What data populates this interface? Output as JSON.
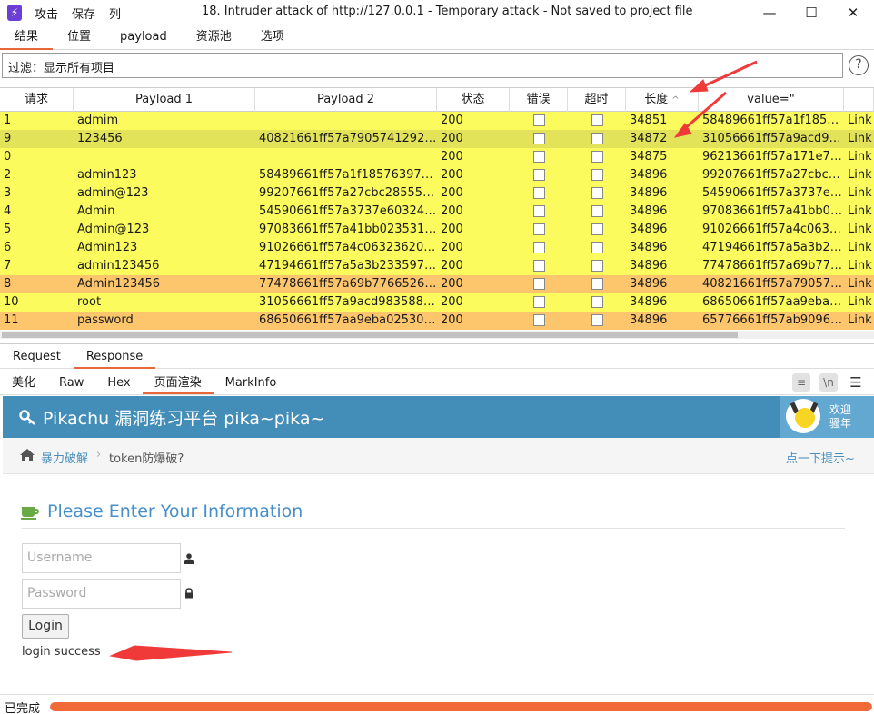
{
  "app": {
    "icon_glyph": "⚡",
    "menu": [
      "攻击",
      "保存",
      "列"
    ],
    "window_title": "18. Intruder attack of http://127.0.0.1 - Temporary attack - Not saved to project file",
    "window_buttons": {
      "minimize": "—",
      "maximize": "☐",
      "close": "✕"
    }
  },
  "main_tabs": [
    "结果",
    "位置",
    "payload",
    "资源池",
    "选项"
  ],
  "filter": {
    "text": "过滤：显示所有项目",
    "help": "?"
  },
  "table": {
    "columns": [
      "请求",
      "Payload 1",
      "Payload 2",
      "状态",
      "错误",
      "超时",
      "长度",
      "value=\""
    ],
    "sort_indicator": "^",
    "rows": [
      {
        "id": "1",
        "p1": "admim",
        "p2": "",
        "status": "200",
        "len": "34851",
        "value": "58489661ff57a1f1857...",
        "extra": "Link",
        "highlight": "yellow"
      },
      {
        "id": "9",
        "p1": "123456",
        "p2": "40821661ff57a79057412924...",
        "status": "200",
        "len": "34872",
        "value": "31056661ff57a9acd98...",
        "extra": "Link",
        "highlight": "selected"
      },
      {
        "id": "0",
        "p1": "",
        "p2": "",
        "status": "200",
        "len": "34875",
        "value": "96213661ff57a171e72...",
        "extra": "Link",
        "highlight": "yellow"
      },
      {
        "id": "2",
        "p1": "admin123",
        "p2": "58489661ff57a1f185763978...",
        "status": "200",
        "len": "34896",
        "value": "99207661ff57a27cbc2...",
        "extra": "Link",
        "highlight": "yellow"
      },
      {
        "id": "3",
        "p1": "admin@123",
        "p2": "99207661ff57a27cbc285555...",
        "status": "200",
        "len": "34896",
        "value": "54590661ff57a3737e6...",
        "extra": "Link",
        "highlight": "yellow"
      },
      {
        "id": "4",
        "p1": "Admin",
        "p2": "54590661ff57a3737e603246...",
        "status": "200",
        "len": "34896",
        "value": "97083661ff57a41bb02...",
        "extra": "Link",
        "highlight": "yellow"
      },
      {
        "id": "5",
        "p1": "Admin@123",
        "p2": "97083661ff57a41bb0235316...",
        "status": "200",
        "len": "34896",
        "value": "91026661ff57a4c0632...",
        "extra": "Link",
        "highlight": "yellow"
      },
      {
        "id": "6",
        "p1": "Admin123",
        "p2": "91026661ff57a4c063236205...",
        "status": "200",
        "len": "34896",
        "value": "47194661ff57a5a3b23...",
        "extra": "Link",
        "highlight": "yellow"
      },
      {
        "id": "7",
        "p1": "admin123456",
        "p2": "47194661ff57a5a3b2335977...",
        "status": "200",
        "len": "34896",
        "value": "77478661ff57a69b776...",
        "extra": "Link",
        "highlight": "yellow"
      },
      {
        "id": "8",
        "p1": "Admin123456",
        "p2": "77478661ff57a69b77665265...",
        "status": "200",
        "len": "34896",
        "value": "40821661ff57a790574...",
        "extra": "Link",
        "highlight": "orange"
      },
      {
        "id": "10",
        "p1": "root",
        "p2": "31056661ff57a9acd9835883...",
        "status": "200",
        "len": "34896",
        "value": "68650661ff57aa9eba0...",
        "extra": "Link",
        "highlight": "yellow"
      },
      {
        "id": "11",
        "p1": "password",
        "p2": "68650661ff57aa9eba025300...",
        "status": "200",
        "len": "34896",
        "value": "65776661ff57ab90963...",
        "extra": "Link",
        "highlight": "orange"
      }
    ]
  },
  "rr_tabs": [
    "Request",
    "Response"
  ],
  "view_tabs": [
    "美化",
    "Raw",
    "Hex",
    "页面渲染",
    "MarkInfo"
  ],
  "view_icons": {
    "wrap": "≡",
    "newline": "\\n",
    "menu": "☰"
  },
  "page": {
    "header_title": "Pikachu 漏洞练习平台 pika~pika~",
    "welcome_line1": "欢迎",
    "welcome_line2": "骚年",
    "breadcrumb_link": "暴力破解",
    "breadcrumb_sep": "›",
    "breadcrumb_current": "token防爆破?",
    "hint": "点一下提示~",
    "info_title": "Please Enter Your Information",
    "username_placeholder": "Username",
    "password_placeholder": "Password",
    "login_label": "Login",
    "login_message": "login success"
  },
  "status": {
    "text": "已完成",
    "progress": 1.0
  },
  "colors": {
    "accent": "#e8673a",
    "row_yellow": "#fbfb5e",
    "row_orange": "#fdc66c",
    "pikachu_header": "#438eb9",
    "annotation_arrow": "#f03a3a"
  }
}
